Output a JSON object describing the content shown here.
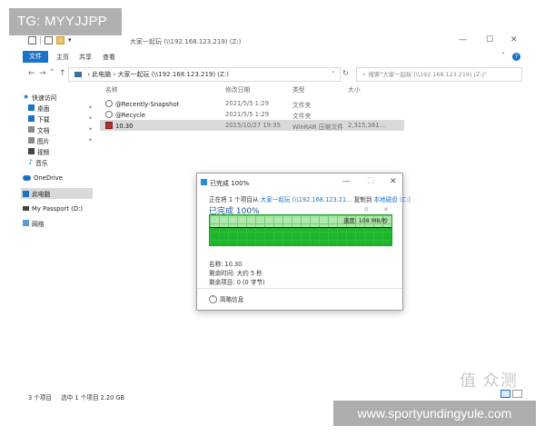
{
  "overlay": {
    "tg_label": "TG: MYYJJPP",
    "site_label": "www.sportyundingyule.com",
    "corner_mark": "值 众测"
  },
  "window": {
    "title": "大家一起玩 (\\\\192.168.123.219) (Z:)",
    "controls": {
      "minimize": "—",
      "maximize": "☐",
      "close": "✕"
    }
  },
  "ribbon": {
    "file_tab": "文件",
    "tabs": [
      "主页",
      "共享",
      "查看"
    ],
    "expand_icon": "chevron-down-icon",
    "help_label": "?"
  },
  "address": {
    "back": "←",
    "forward": "→",
    "recent": "˅",
    "up": "↑",
    "path_root": "此电脑",
    "path_sep": "›",
    "path_current": "大家一起玩 (\\\\192.168.123.219) (Z:)",
    "dropdown": "˅",
    "refresh": "↻",
    "search_placeholder": "搜索\"大家一起玩 (\\\\192.168.123.219) (Z:)\""
  },
  "sidebar": {
    "items": [
      {
        "label": "快速访问",
        "icon": "star-icon",
        "pinned": false
      },
      {
        "label": "桌面",
        "icon": "desktop-icon",
        "pinned": true
      },
      {
        "label": "下载",
        "icon": "download-icon",
        "pinned": true
      },
      {
        "label": "文档",
        "icon": "document-icon",
        "pinned": true
      },
      {
        "label": "图片",
        "icon": "picture-icon",
        "pinned": true
      },
      {
        "label": "视频",
        "icon": "video-icon",
        "pinned": false
      },
      {
        "label": "音乐",
        "icon": "music-icon",
        "pinned": false
      },
      {
        "label": "OneDrive",
        "icon": "cloud-icon",
        "pinned": false
      },
      {
        "label": "此电脑",
        "icon": "computer-icon",
        "pinned": false,
        "selected": true
      },
      {
        "label": "My Passport (D:)",
        "icon": "drive-icon",
        "pinned": false
      },
      {
        "label": "网络",
        "icon": "network-icon",
        "pinned": false
      }
    ],
    "pin_glyph": "✦"
  },
  "filelist": {
    "columns": [
      "名称",
      "修改日期",
      "类型",
      "大小"
    ],
    "rows": [
      {
        "name": "@Recently-Snapshot",
        "date": "2021/5/5 1:29",
        "type": "文件夹",
        "size": "",
        "icon": "folder-icon",
        "selected": false
      },
      {
        "name": "@Recycle",
        "date": "2021/5/5 1:29",
        "type": "文件夹",
        "size": "",
        "icon": "folder-icon",
        "selected": false
      },
      {
        "name": "10.30",
        "date": "2015/10/27 19:35",
        "type": "WinRAR 压缩文件",
        "size": "2,315,361...",
        "icon": "rar-archive-icon",
        "selected": true
      }
    ]
  },
  "statusbar": {
    "count": "3 个项目",
    "selection": "选中 1 个项目  2.20 GB"
  },
  "dialog": {
    "title": "已完成 100%",
    "line_prefix": "正在将 1 个项目从",
    "source": "大家一起玩 (\\\\192.168.123.21...",
    "line_mid": "复制到",
    "dest": "本地磁盘 (C:)",
    "progress_label": "已完成 100%",
    "pause_glyph": "II",
    "cancel_glyph": "✕",
    "speed": "速度: 108 MB/秒",
    "progress_percent": 100,
    "info_name": "名称: 10.30",
    "info_time": "剩余时间: 大约 5 秒",
    "info_items": "剩余项目: 0 (0 字节)",
    "toggle_label": "简略信息",
    "controls": {
      "minimize": "—",
      "maximize": "☐",
      "close": "✕"
    }
  },
  "colors": {
    "accent": "#1a73c7",
    "progress_green": "#1fb52e",
    "selection_grey": "#d9d9d9"
  }
}
